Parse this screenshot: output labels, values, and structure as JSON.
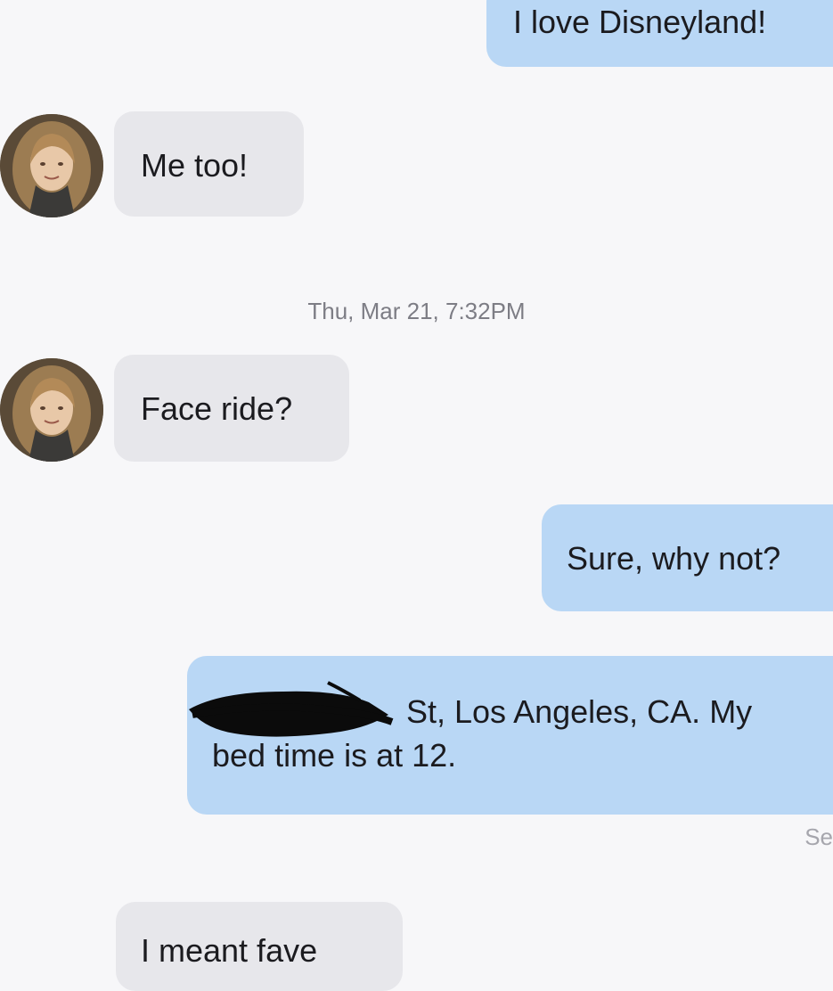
{
  "messages": [
    {
      "direction": "sent",
      "text": "I love Disneyland!"
    },
    {
      "direction": "received",
      "text": "Me too!"
    },
    {
      "direction": "received",
      "text": "Face ride?"
    },
    {
      "direction": "sent",
      "text": "Sure, why not?"
    },
    {
      "direction": "sent",
      "text_line1": "St, Los Angeles, CA. My",
      "text_line2": "bed time is at 12."
    },
    {
      "direction": "received",
      "text": "I meant fave"
    }
  ],
  "timestamp": "Thu, Mar 21, 7:32PM",
  "status": "Se",
  "colors": {
    "sent_bubble": "#b9d7f5",
    "received_bubble": "#e7e7eb",
    "background": "#f7f7f9",
    "redaction": "#000000"
  },
  "icons": {
    "contact_avatar": "avatar",
    "redaction_mark": "scribble"
  }
}
